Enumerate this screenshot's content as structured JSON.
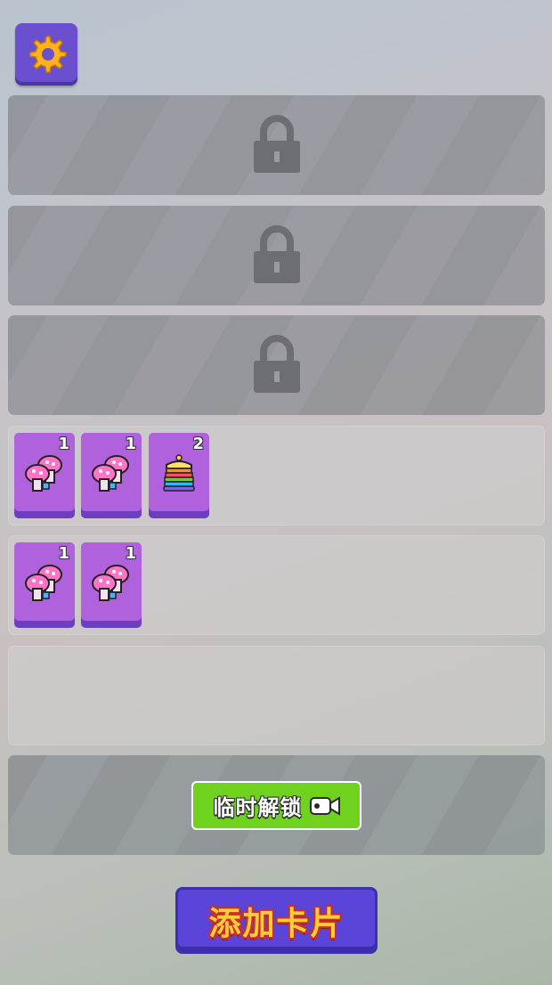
{
  "settings": {
    "icon": "gear-icon"
  },
  "rows": [
    {
      "state": "locked",
      "icon": "lock-icon"
    },
    {
      "state": "locked",
      "icon": "lock-icon"
    },
    {
      "state": "locked",
      "icon": "lock-icon"
    },
    {
      "state": "open",
      "cards": [
        {
          "item": "mushroom-icon",
          "count": "1"
        },
        {
          "item": "mushroom-icon",
          "count": "1"
        },
        {
          "item": "cake-icon",
          "count": "2"
        }
      ]
    },
    {
      "state": "open",
      "cards": [
        {
          "item": "mushroom-icon",
          "count": "1"
        },
        {
          "item": "mushroom-icon",
          "count": "1"
        }
      ]
    },
    {
      "state": "open",
      "cards": []
    },
    {
      "state": "temp-locked"
    }
  ],
  "temp_unlock": {
    "label": "临时解锁",
    "icon": "video-camera-icon"
  },
  "add_card": {
    "label": "添加卡片"
  },
  "colors": {
    "card": "#b062dd",
    "button_purple": "#5a45d8",
    "button_green": "#6fd21f",
    "add_text": "#ffcc3a"
  }
}
